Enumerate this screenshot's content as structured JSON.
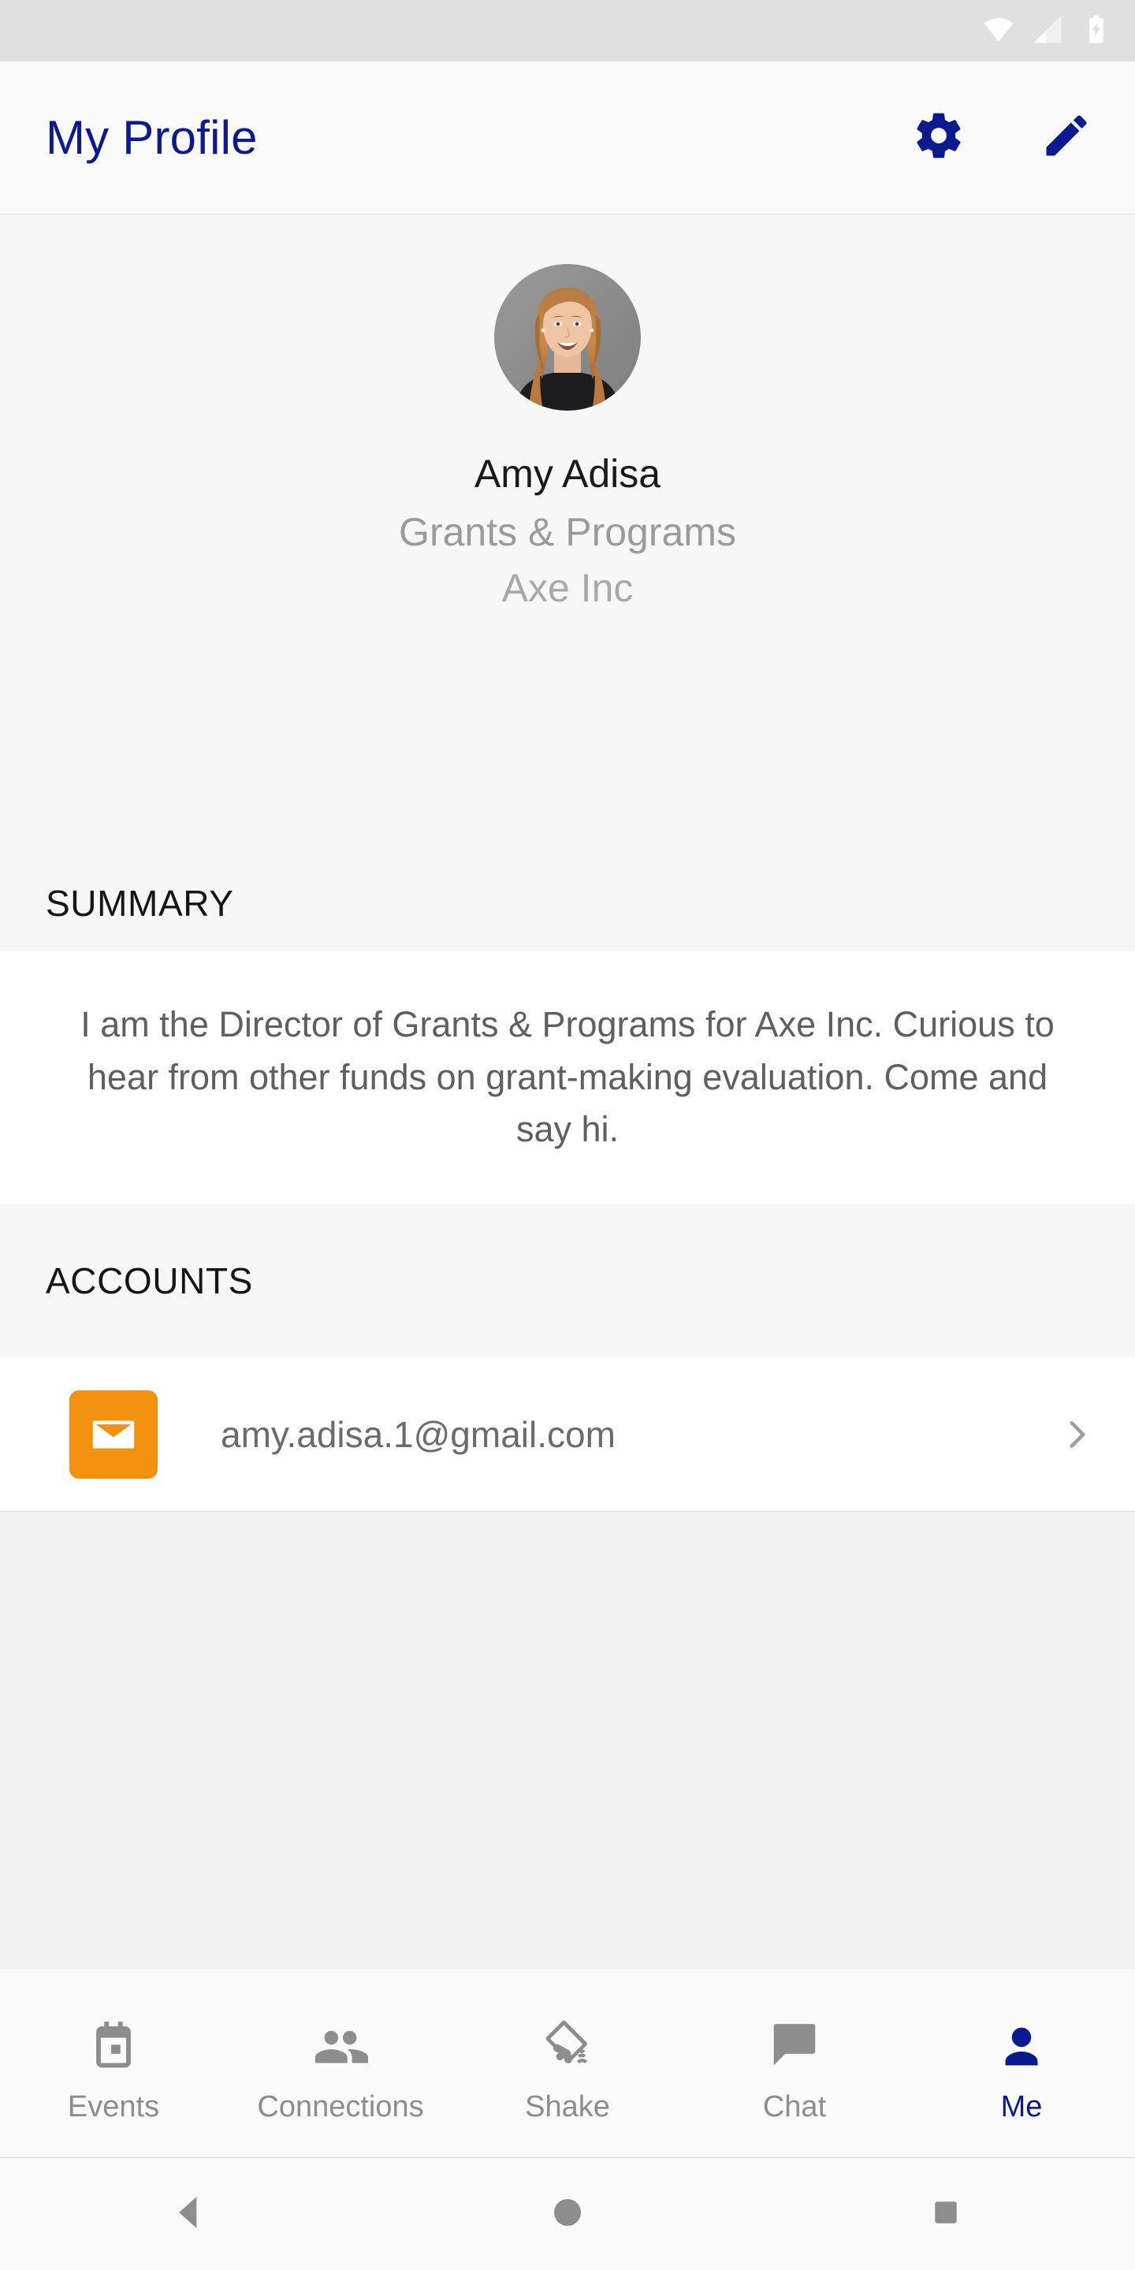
{
  "statusbar": {
    "icons": [
      "wifi-icon",
      "cell-signal-icon",
      "battery-charging-icon"
    ]
  },
  "appbar": {
    "title": "My Profile",
    "settings_icon": "gear-icon",
    "edit_icon": "pencil-icon",
    "title_color": "#0b1a8f"
  },
  "profile": {
    "avatar_alt": "profile-photo",
    "name": "Amy Adisa",
    "title": "Grants & Programs",
    "company": "Axe Inc"
  },
  "summary": {
    "heading": "SUMMARY",
    "text": "I am the Director of Grants & Programs for Axe Inc. Curious to hear from other funds on grant-making evaluation. Come and say hi."
  },
  "accounts": {
    "heading": "ACCOUNTS",
    "items": [
      {
        "icon": "mail-icon",
        "icon_color": "#f2900f",
        "value": "amy.adisa.1@gmail.com",
        "chevron": "chevron-right-icon"
      }
    ]
  },
  "tabs": [
    {
      "label": "Events",
      "icon": "calendar-icon",
      "active": false
    },
    {
      "label": "Connections",
      "icon": "people-icon",
      "active": false
    },
    {
      "label": "Shake",
      "icon": "shake-phone-icon",
      "active": false
    },
    {
      "label": "Chat",
      "icon": "speech-bubble-icon",
      "active": false
    },
    {
      "label": "Me",
      "icon": "person-icon",
      "active": true
    }
  ],
  "navbar": {
    "back": "back-triangle-icon",
    "home": "home-circle-icon",
    "recents": "recents-square-icon"
  },
  "colors": {
    "accent": "#0b1a8f",
    "mail": "#f2900f",
    "page_bg": "#f7f7f7",
    "card_bg": "#ffffff",
    "muted_text": "#9b9b9b"
  }
}
